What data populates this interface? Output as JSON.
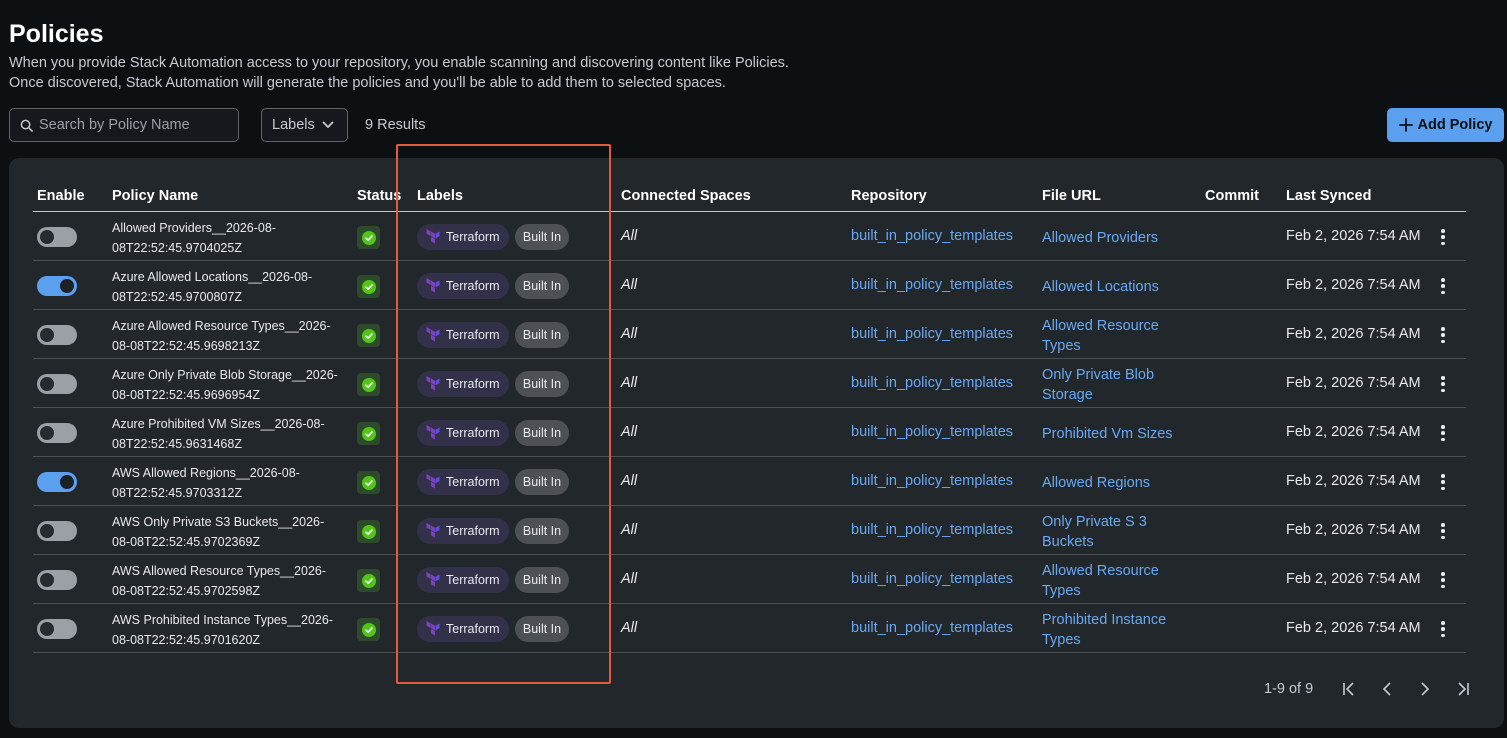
{
  "page": {
    "title": "Policies",
    "description_line1": "When you provide Stack Automation access to your repository, you enable scanning and discovering content like Policies.",
    "description_line2": "Once discovered, Stack Automation will generate the policies and you'll be able to add them to selected spaces."
  },
  "toolbar": {
    "search_placeholder": "Search by Policy Name",
    "labels_filter": "Labels",
    "results_count": "9 Results",
    "add_button": "Add Policy"
  },
  "columns": {
    "enable": "Enable",
    "policy_name": "Policy Name",
    "status": "Status",
    "labels": "Labels",
    "connected_spaces": "Connected Spaces",
    "repository": "Repository",
    "file_url": "File URL",
    "commit": "Commit",
    "last_synced": "Last Synced"
  },
  "rows": [
    {
      "enabled": false,
      "name_line1": "Allowed Providers__2026-08-",
      "name_line2": "08T22:52:45.9704025Z",
      "label_terraform": "Terraform",
      "label_builtin": "Built In",
      "spaces": "All",
      "repository": "built_in_policy_templates",
      "file_url_line1": "Allowed Providers",
      "file_url_line2": "",
      "last_synced": "Feb 2, 2026 7:54 AM"
    },
    {
      "enabled": true,
      "name_line1": "Azure Allowed Locations__2026-08-",
      "name_line2": "08T22:52:45.9700807Z",
      "label_terraform": "Terraform",
      "label_builtin": "Built In",
      "spaces": "All",
      "repository": "built_in_policy_templates",
      "file_url_line1": "Allowed Locations",
      "file_url_line2": "",
      "last_synced": "Feb 2, 2026 7:54 AM"
    },
    {
      "enabled": false,
      "name_line1": "Azure Allowed Resource Types__2026-",
      "name_line2": "08-08T22:52:45.9698213Z",
      "label_terraform": "Terraform",
      "label_builtin": "Built In",
      "spaces": "All",
      "repository": "built_in_policy_templates",
      "file_url_line1": "Allowed Resource",
      "file_url_line2": "Types",
      "last_synced": "Feb 2, 2026 7:54 AM"
    },
    {
      "enabled": false,
      "name_line1": "Azure Only Private Blob Storage__2026-",
      "name_line2": "08-08T22:52:45.9696954Z",
      "label_terraform": "Terraform",
      "label_builtin": "Built In",
      "spaces": "All",
      "repository": "built_in_policy_templates",
      "file_url_line1": "Only Private Blob",
      "file_url_line2": "Storage",
      "last_synced": "Feb 2, 2026 7:54 AM"
    },
    {
      "enabled": false,
      "name_line1": "Azure Prohibited VM Sizes__2026-08-",
      "name_line2": "08T22:52:45.9631468Z",
      "label_terraform": "Terraform",
      "label_builtin": "Built In",
      "spaces": "All",
      "repository": "built_in_policy_templates",
      "file_url_line1": "Prohibited Vm Sizes",
      "file_url_line2": "",
      "last_synced": "Feb 2, 2026 7:54 AM"
    },
    {
      "enabled": true,
      "name_line1": "AWS Allowed Regions__2026-08-",
      "name_line2": "08T22:52:45.9703312Z",
      "label_terraform": "Terraform",
      "label_builtin": "Built In",
      "spaces": "All",
      "repository": "built_in_policy_templates",
      "file_url_line1": "Allowed Regions",
      "file_url_line2": "",
      "last_synced": "Feb 2, 2026 7:54 AM"
    },
    {
      "enabled": false,
      "name_line1": "AWS Only Private S3 Buckets__2026-",
      "name_line2": "08-08T22:52:45.9702369Z",
      "label_terraform": "Terraform",
      "label_builtin": "Built In",
      "spaces": "All",
      "repository": "built_in_policy_templates",
      "file_url_line1": "Only Private S 3",
      "file_url_line2": "Buckets",
      "last_synced": "Feb 2, 2026 7:54 AM"
    },
    {
      "enabled": false,
      "name_line1": "AWS Allowed Resource Types__2026-",
      "name_line2": "08-08T22:52:45.9702598Z",
      "label_terraform": "Terraform",
      "label_builtin": "Built In",
      "spaces": "All",
      "repository": "built_in_policy_templates",
      "file_url_line1": "Allowed Resource",
      "file_url_line2": "Types",
      "last_synced": "Feb 2, 2026 7:54 AM"
    },
    {
      "enabled": false,
      "name_line1": "AWS Prohibited Instance Types__2026-",
      "name_line2": "08-08T22:52:45.9701620Z",
      "label_terraform": "Terraform",
      "label_builtin": "Built In",
      "spaces": "All",
      "repository": "built_in_policy_templates",
      "file_url_line1": "Prohibited Instance",
      "file_url_line2": "Types",
      "last_synced": "Feb 2, 2026 7:54 AM"
    }
  ],
  "pagination": {
    "range_text": "1-9 of 9"
  },
  "colors": {
    "accent": "#5aa0ef",
    "link": "#6aa8f2",
    "status_ok": "#52c41a",
    "terraform": "#7b42bc",
    "highlight": "#e45a3a"
  },
  "icons": [
    "search-icon",
    "chevron-down-icon",
    "plus-icon",
    "check-circle-icon",
    "terraform-icon",
    "kebab-menu-icon",
    "first-page-icon",
    "prev-page-icon",
    "next-page-icon",
    "last-page-icon"
  ]
}
